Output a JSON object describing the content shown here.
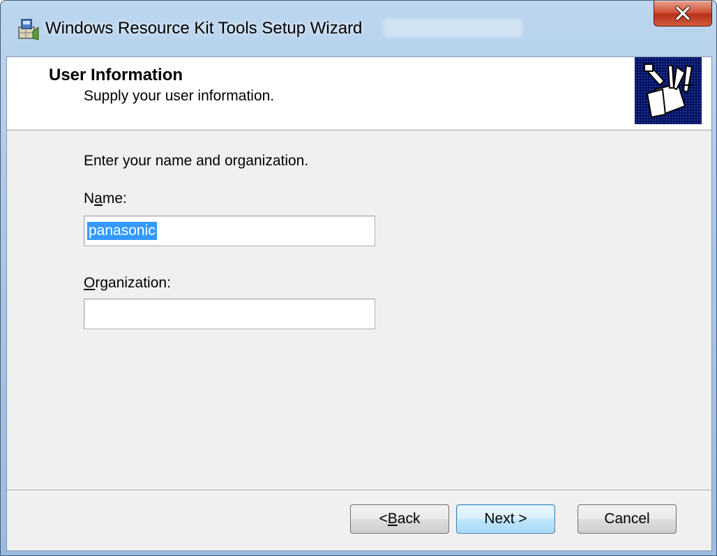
{
  "window": {
    "title": "Windows Resource Kit Tools Setup Wizard",
    "close_label": "x"
  },
  "header": {
    "title": "User Information",
    "subtitle": "Supply your user information."
  },
  "form": {
    "prompt": "Enter your name and organization.",
    "name_label_pre": "N",
    "name_label_accel": "a",
    "name_label_post": "me:",
    "name_value": "panasonic",
    "org_label_accel": "O",
    "org_label_post": "rganization:",
    "org_value": ""
  },
  "buttons": {
    "back_pre": "< ",
    "back_accel": "B",
    "back_post": "ack",
    "next": "Next >",
    "cancel": "Cancel"
  },
  "icons": {
    "title": "setup-wizard-icon",
    "banner": "toolbox-folder-icon",
    "close": "close-icon"
  },
  "colors": {
    "selection": "#3399ff",
    "close_button": "#c8452a",
    "banner": "#001060",
    "default_button": "#bee6fd"
  }
}
